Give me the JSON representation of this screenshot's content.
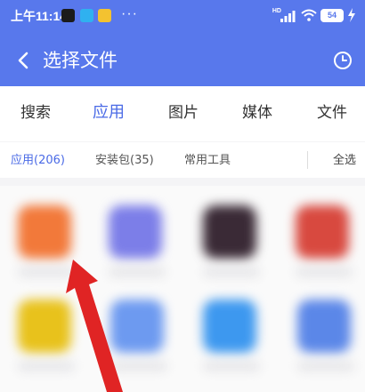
{
  "status_bar": {
    "time": "上午11:14",
    "dots": "···",
    "network": "HD",
    "battery": "54"
  },
  "title_bar": {
    "title": "选择文件"
  },
  "category_tabs": [
    {
      "label": "搜索",
      "active": false
    },
    {
      "label": "应用",
      "active": true
    },
    {
      "label": "图片",
      "active": false
    },
    {
      "label": "媒体",
      "active": false
    },
    {
      "label": "文件",
      "active": false
    }
  ],
  "sub_tabs": [
    {
      "label": "应用(206)",
      "active": true
    },
    {
      "label": "安装包(35)",
      "active": false
    },
    {
      "label": "常用工具",
      "active": false
    }
  ],
  "select_all": "全选",
  "colors": {
    "header_blue": "#5878ec",
    "accent_blue": "#4a6ae6",
    "arrow_red": "#e02424"
  },
  "app_icons": [
    {
      "color": "#f2793a"
    },
    {
      "color": "#7c7ee8"
    },
    {
      "color": "#3a2a36"
    },
    {
      "color": "#d8493f"
    },
    {
      "color": "#e8c21c"
    },
    {
      "color": "#6d9af0"
    },
    {
      "color": "#3d98ef"
    },
    {
      "color": "#5b87e8"
    }
  ]
}
